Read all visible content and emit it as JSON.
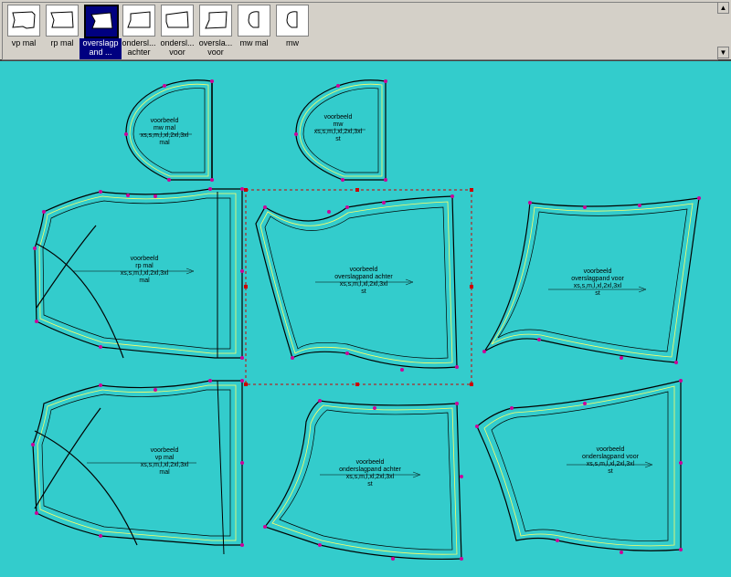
{
  "toolbar": {
    "pieces": [
      {
        "label": "vp mal",
        "icon": "bodice-piece-icon",
        "selected": false
      },
      {
        "label": "rp mal",
        "icon": "bodice-piece-icon",
        "selected": false
      },
      {
        "label": "overslagp and ...",
        "icon": "bodice-piece-icon",
        "selected": true
      },
      {
        "label": "ondersl... achter",
        "icon": "bodice-piece-icon",
        "selected": false
      },
      {
        "label": "ondersl... voor",
        "icon": "bodice-piece-icon",
        "selected": false
      },
      {
        "label": "overslа... voor",
        "icon": "bodice-piece-icon",
        "selected": false
      },
      {
        "label": "mw mal",
        "icon": "sleeve-piece-icon",
        "selected": false
      },
      {
        "label": "mw",
        "icon": "sleeve-piece-icon",
        "selected": false
      }
    ]
  },
  "pieces": {
    "mw_mal": {
      "name": "voorbeeld",
      "sub": "mw mal",
      "sizes": "xs,s,m,l,xl,2xl,3xl",
      "tag": "mal"
    },
    "mw": {
      "name": "voorbeeld",
      "sub": "mw",
      "sizes": "xs,s,m,l,xl,2xl,3xl",
      "tag": "st"
    },
    "rp_mal": {
      "name": "voorbeeld",
      "sub": "rp mal",
      "sizes": "xs,s,m,l,xl,2xl,3xl",
      "tag": "mal"
    },
    "overslag_achter": {
      "name": "voorbeeld",
      "sub": "overslagpand achter",
      "sizes": "xs,s,m,l,xl,2xl,3xl",
      "tag": "st"
    },
    "overslag_voor": {
      "name": "voorbeeld",
      "sub": "overslagpand voor",
      "sizes": "xs,s,m,l,xl,2xl,3xl",
      "tag": "st"
    },
    "vp_mal": {
      "name": "voorbeeld",
      "sub": "vp mal",
      "sizes": "xs,s,m,l,xl,2xl,3xl",
      "tag": "mal"
    },
    "onderslag_achter": {
      "name": "voorbeeld",
      "sub": "onderslagpand achter",
      "sizes": "xs,s,m,l,xl,2xl,3xl",
      "tag": "st"
    },
    "onderslag_voor": {
      "name": "voorbeeld",
      "sub": "onderslagpand voor",
      "sizes": "xs,s,m,l,xl,2xl,3xl",
      "tag": "st"
    }
  },
  "colors": {
    "background": "#33cccc",
    "outline": "#000000",
    "grade_line": "#ffff66",
    "point": "#cc0099",
    "selection": "#cc0000"
  }
}
